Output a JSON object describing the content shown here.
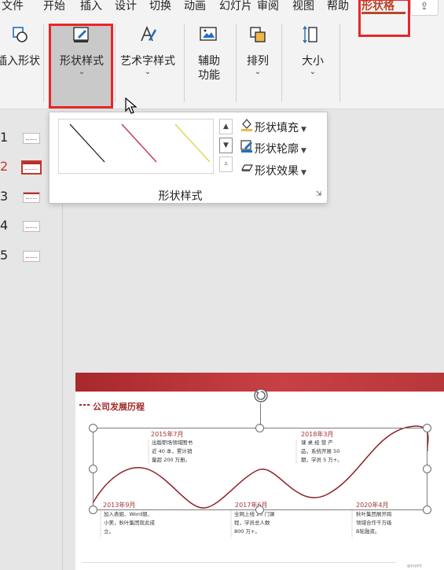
{
  "tabs": [
    {
      "label": "文件",
      "active": false
    },
    {
      "label": "开始",
      "active": false
    },
    {
      "label": "插入",
      "active": false
    },
    {
      "label": "设计",
      "active": false
    },
    {
      "label": "切换",
      "active": false
    },
    {
      "label": "动画",
      "active": false
    },
    {
      "label": "幻灯片",
      "active": false
    },
    {
      "label": "审阅",
      "active": false
    },
    {
      "label": "视图",
      "active": false
    },
    {
      "label": "帮助",
      "active": false
    },
    {
      "label": "形状格",
      "active": true
    }
  ],
  "ribbon": {
    "insert_shape": "插入形状",
    "shape_styles": "形状样式",
    "wordart_styles": "艺术字样式",
    "accessibility": "辅助功能",
    "arrange": "排列",
    "size": "大小"
  },
  "slides": [
    {
      "num": "1",
      "selected": false
    },
    {
      "num": "2",
      "selected": true
    },
    {
      "num": "3",
      "selected": false
    },
    {
      "num": "4",
      "selected": false
    },
    {
      "num": "5",
      "selected": false
    }
  ],
  "gallery": {
    "title": "形状样式",
    "fill": "形状填充",
    "outline": "形状轮廓",
    "effects": "形状效果",
    "line_colors": [
      "#2b2b2b",
      "#b83545",
      "#d9d445"
    ]
  },
  "slide": {
    "title": "公司发展历程",
    "milestones": [
      {
        "year": "2015年7月",
        "text": [
          "出版职场领域图书",
          "近 40 本，累计销",
          "量超 200 万册。"
        ]
      },
      {
        "year": "2018年3月",
        "text": [
          "课 桌 经 营 产",
          "品，系统开展 50",
          "期，学员 5 万+。"
        ]
      },
      {
        "year": "2013年9月",
        "text": [
          "加入表姐、Word姐、",
          "小美，秋叶集团就此成",
          "立。"
        ]
      },
      {
        "year": "2017年6月",
        "text": [
          "全网上线 20 门课",
          "程，学员总人数",
          "800 万+。"
        ]
      },
      {
        "year": "2020年4月",
        "text": [
          "秋叶集团展开跨",
          "领域合作千万级",
          "B轮融资。"
        ]
      }
    ],
    "corner_note": "秋叶PPT"
  },
  "colors": {
    "accent": "#b7472a",
    "highlight": "#e8262b",
    "brand_red": "#a8282b"
  }
}
